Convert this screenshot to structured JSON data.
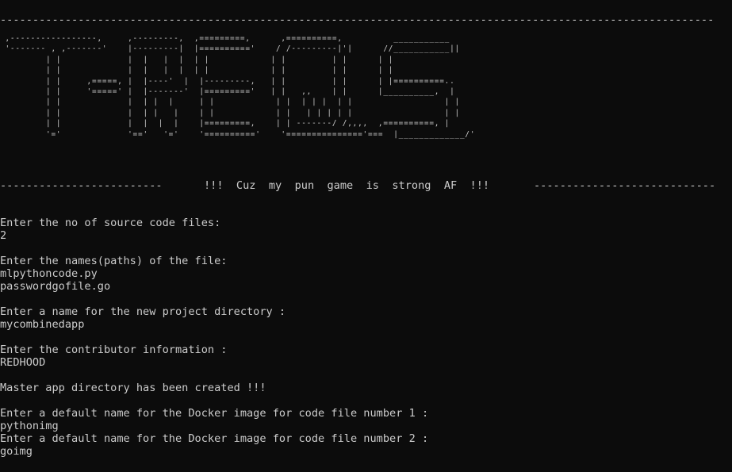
{
  "terminal": {
    "top_rule": "--------------------------------------------------------------------------------------------------------------",
    "banner_art": [
      " ,-----------------,     ,---------,  ,=========,      ,==========,          ___________",
      " '------- , ,-------'    |---------|  |=========='    / /---------|'|      //___________||",
      "         | |             |  |   |  |  | |            | |         | |      | |",
      "         | |             |  |   |  |  | |            | |         | |      | |",
      "         | |     ,=====, |  |----'  |  |---------,   | |         | |      | |==========..",
      "         | |     '=====' |  |-------'  |========='   | |   ,,    | |      |__________,  |",
      "         | |             |  | |  |     | |            | |  | | |  | |                  | |",
      "         | |             |  | |   |    | |            | |   | | | | |                  | |",
      "         | |             |  |  |  |    |=========,    | | -------/ /,,,,  ,==========, |",
      "         '='             '=='   '='    '=========='    '==============='===  |_____________/'"
    ],
    "tagline_left_rule": "-------------------------",
    "tagline_text": "!!!  Cuz  my  pun  game  is  strong  AF  !!!",
    "tagline_right_rule": "----------------------------",
    "prompt_files_count": "Enter the no of source code files:",
    "answer_files_count": "2",
    "prompt_file_names": "Enter the names(paths) of the file:",
    "answer_file_1": "mlpythoncode.py",
    "answer_file_2": "passwordgofile.go",
    "prompt_project_dir": "Enter a name for the new project directory :",
    "answer_project_dir": "mycombinedapp",
    "prompt_contributor": "Enter the contributor information :",
    "answer_contributor": "REDHOOD",
    "status_created": "Master app directory has been created !!!",
    "prompt_docker_1": "Enter a default name for the Docker image for code file number 1 :",
    "answer_docker_1": "pythonimg",
    "prompt_docker_2": "Enter a default name for the Docker image for code file number 2 :",
    "answer_docker_2": "goimg"
  }
}
